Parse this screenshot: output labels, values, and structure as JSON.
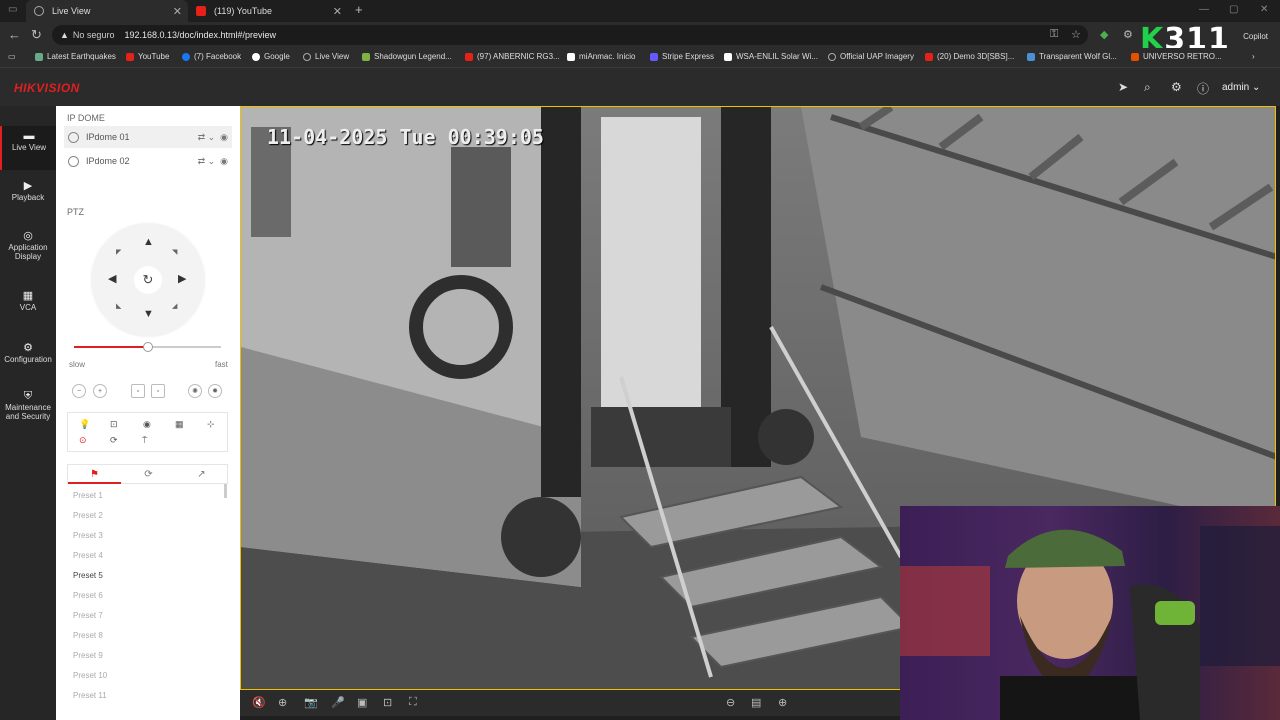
{
  "browser": {
    "tabs": [
      {
        "title": "Live View",
        "active": true
      },
      {
        "title": "(119) YouTube",
        "active": false
      }
    ],
    "url_security": "No seguro",
    "url": "192.168.0.13/doc/index.html#/preview",
    "copilot_label": "Copilot",
    "overlay_text": "311",
    "bookmarks": [
      "Latest Earthquakes",
      "YouTube",
      "(7) Facebook",
      "Google",
      "Live View",
      "Shadowgun Legend...",
      "(97) ANBERNIC RG3...",
      "miAnmac. Inicio",
      "Stripe Express",
      "WSA-ENLIL Solar Wi...",
      "Official UAP Imagery",
      "(20) Demo 3D[SBS]...",
      "Transparent Wolf Gl...",
      "UNIVERSO RETRO..."
    ]
  },
  "app": {
    "brand": "HIKVISION",
    "user": "admin",
    "nav": [
      {
        "label": "Live View",
        "icon": "monitor-icon",
        "active": true
      },
      {
        "label": "Playback",
        "icon": "play-icon",
        "active": false
      },
      {
        "label": "Application Display",
        "icon": "compass-icon",
        "active": false
      },
      {
        "label": "VCA",
        "icon": "grid-icon",
        "active": false
      },
      {
        "label": "Configuration",
        "icon": "gear-icon",
        "active": false
      },
      {
        "label": "Maintenance and Security",
        "icon": "shield-icon",
        "active": false
      }
    ]
  },
  "panel": {
    "device_section": "IP DOME",
    "cameras": [
      "IPdome 01",
      "IPdome 02"
    ],
    "ptz_section": "PTZ",
    "speed_slow": "slow",
    "speed_fast": "fast",
    "speed_level": 0.5,
    "presets": [
      "Preset 1",
      "Preset 2",
      "Preset 3",
      "Preset 4",
      "Preset 5",
      "Preset 6",
      "Preset 7",
      "Preset 8",
      "Preset 9",
      "Preset 10",
      "Preset 11"
    ],
    "active_preset": "Preset 5"
  },
  "video": {
    "timestamp": "11-04-2025 Tue 00:39:05"
  },
  "colors": {
    "brand_red": "#e02020",
    "video_border": "#f0c000"
  }
}
